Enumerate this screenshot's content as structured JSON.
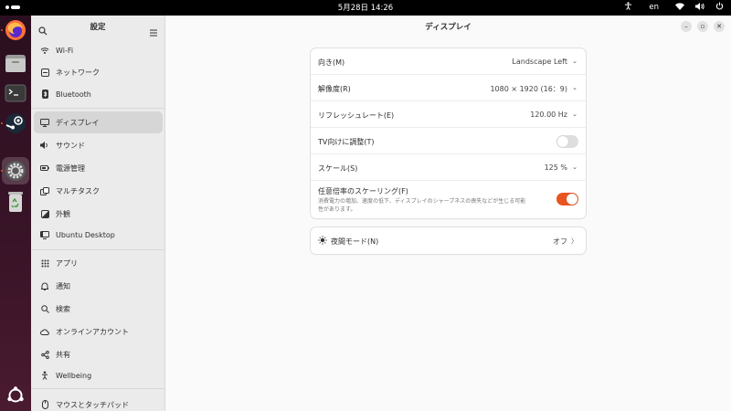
{
  "topbar": {
    "clock": "5月28日  14:26",
    "language": "en"
  },
  "dock": {
    "apps": [
      {
        "name": "firefox-icon"
      },
      {
        "name": "files-icon"
      },
      {
        "name": "terminal-icon"
      },
      {
        "name": "steam-icon"
      },
      {
        "name": "settings-icon"
      },
      {
        "name": "trash-icon"
      },
      {
        "name": "ubuntu-logo-icon"
      }
    ]
  },
  "sidebar": {
    "title": "設定",
    "items": [
      {
        "label": "Wi-Fi",
        "icon": "wifi-icon"
      },
      {
        "label": "ネットワーク",
        "icon": "network-icon"
      },
      {
        "label": "Bluetooth",
        "icon": "bluetooth-icon"
      },
      {
        "label": "ディスプレイ",
        "icon": "display-icon"
      },
      {
        "label": "サウンド",
        "icon": "sound-icon"
      },
      {
        "label": "電源管理",
        "icon": "power-icon"
      },
      {
        "label": "マルチタスク",
        "icon": "multitasking-icon"
      },
      {
        "label": "外観",
        "icon": "appearance-icon"
      },
      {
        "label": "Ubuntu Desktop",
        "icon": "ubuntu-desktop-icon"
      },
      {
        "label": "アプリ",
        "icon": "apps-icon"
      },
      {
        "label": "通知",
        "icon": "bell-icon"
      },
      {
        "label": "検索",
        "icon": "search-icon"
      },
      {
        "label": "オンラインアカウント",
        "icon": "cloud-icon"
      },
      {
        "label": "共有",
        "icon": "share-icon"
      },
      {
        "label": "Wellbeing",
        "icon": "wellbeing-icon"
      },
      {
        "label": "マウスとタッチパッド",
        "icon": "mouse-icon"
      }
    ],
    "active_index": 3
  },
  "main": {
    "title": "ディスプレイ",
    "settings": {
      "orientation": {
        "label": "向き(M)",
        "value": "Landscape Left"
      },
      "resolution": {
        "label": "解像度(R)",
        "value": "1080 × 1920 (16：9)"
      },
      "refresh": {
        "label": "リフレッシュレート(E)",
        "value": "120.00 Hz"
      },
      "tv": {
        "label": "TV向けに調整(T)",
        "on": false
      },
      "scale": {
        "label": "スケール(S)",
        "value": "125 %"
      },
      "fractional": {
        "label": "任意倍率のスケーリング(F)",
        "desc": "消費電力の増加、速度の低下、ディスプレイのシャープネスの喪失などが生じる可能性があります。",
        "on": true
      }
    },
    "night_light": {
      "label": "夜間モード(N)",
      "value": "オフ"
    }
  },
  "colors": {
    "accent": "#e95420",
    "sidebar_bg": "#ebebeb",
    "content_bg": "#fafafa"
  }
}
